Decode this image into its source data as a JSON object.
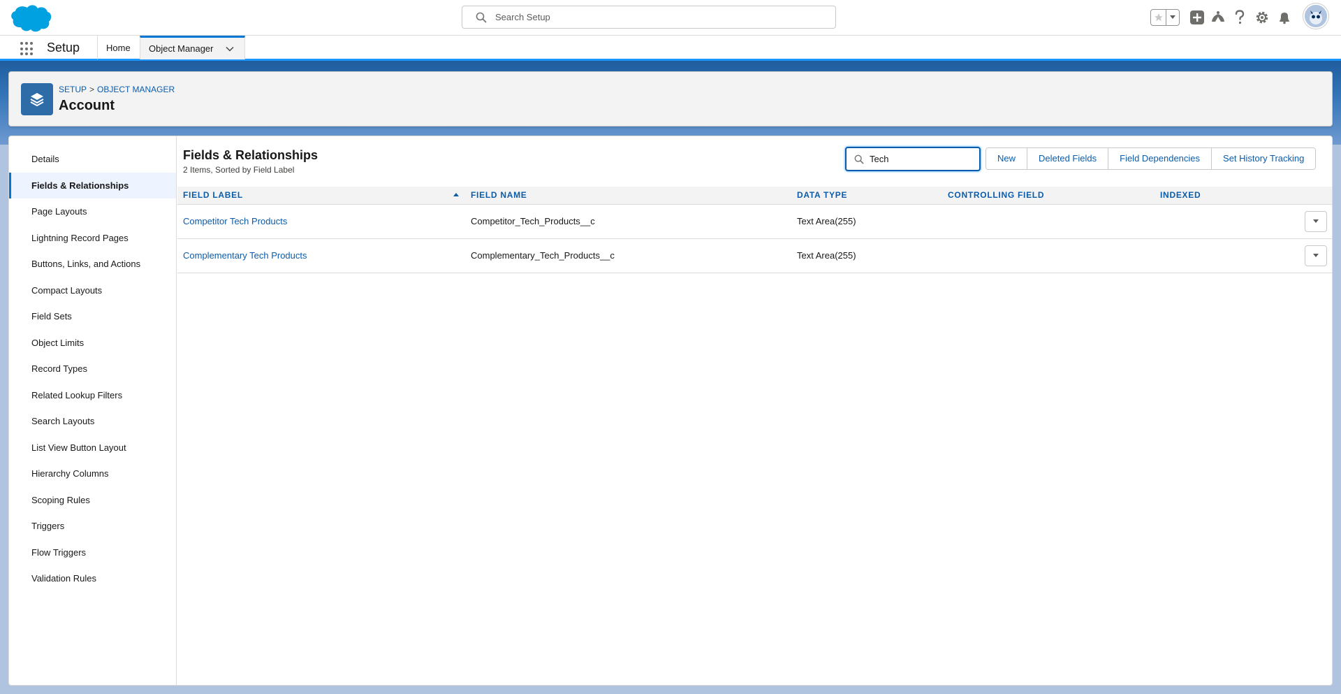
{
  "header": {
    "search_placeholder": "Search Setup",
    "icons": [
      "salesforce-logo",
      "favorites-star-icon",
      "favorites-dropdown-icon",
      "global-actions-plus-icon",
      "trailhead-icon",
      "help-icon",
      "setup-gear-icon",
      "notifications-bell-icon",
      "user-avatar"
    ]
  },
  "context_bar": {
    "app_name": "Setup",
    "tabs": [
      {
        "label": "Home",
        "active": false
      },
      {
        "label": "Object Manager",
        "active": true
      }
    ]
  },
  "page_header": {
    "breadcrumb": [
      "SETUP",
      "OBJECT MANAGER"
    ],
    "breadcrumb_separator": ">",
    "title": "Account"
  },
  "side_nav": {
    "items": [
      {
        "label": "Details",
        "active": false
      },
      {
        "label": "Fields & Relationships",
        "active": true
      },
      {
        "label": "Page Layouts",
        "active": false
      },
      {
        "label": "Lightning Record Pages",
        "active": false
      },
      {
        "label": "Buttons, Links, and Actions",
        "active": false
      },
      {
        "label": "Compact Layouts",
        "active": false
      },
      {
        "label": "Field Sets",
        "active": false
      },
      {
        "label": "Object Limits",
        "active": false
      },
      {
        "label": "Record Types",
        "active": false
      },
      {
        "label": "Related Lookup Filters",
        "active": false
      },
      {
        "label": "Search Layouts",
        "active": false
      },
      {
        "label": "List View Button Layout",
        "active": false
      },
      {
        "label": "Hierarchy Columns",
        "active": false
      },
      {
        "label": "Scoping Rules",
        "active": false
      },
      {
        "label": "Triggers",
        "active": false
      },
      {
        "label": "Flow Triggers",
        "active": false
      },
      {
        "label": "Validation Rules",
        "active": false
      }
    ]
  },
  "content": {
    "title": "Fields & Relationships",
    "subtitle": "2 Items, Sorted by Field Label",
    "quick_find_value": "Tech",
    "buttons": {
      "new": "New",
      "deleted_fields": "Deleted Fields",
      "field_dependencies": "Field Dependencies",
      "set_history_tracking": "Set History Tracking"
    },
    "table": {
      "columns": [
        "FIELD LABEL",
        "FIELD NAME",
        "DATA TYPE",
        "CONTROLLING FIELD",
        "INDEXED"
      ],
      "sorted_column": "FIELD LABEL",
      "sort_direction": "ascending",
      "rows": [
        {
          "field_label": "Competitor Tech Products",
          "field_name": "Competitor_Tech_Products__c",
          "data_type": "Text Area(255)",
          "controlling_field": "",
          "indexed": ""
        },
        {
          "field_label": "Complementary Tech Products",
          "field_name": "Complementary_Tech_Products__c",
          "data_type": "Text Area(255)",
          "controlling_field": "",
          "indexed": ""
        }
      ]
    }
  },
  "colors": {
    "brand_blue": "#0176d3",
    "link_blue": "#0b5cab",
    "object_icon": "#2e6ca8",
    "logo_blue": "#00a1e0"
  }
}
